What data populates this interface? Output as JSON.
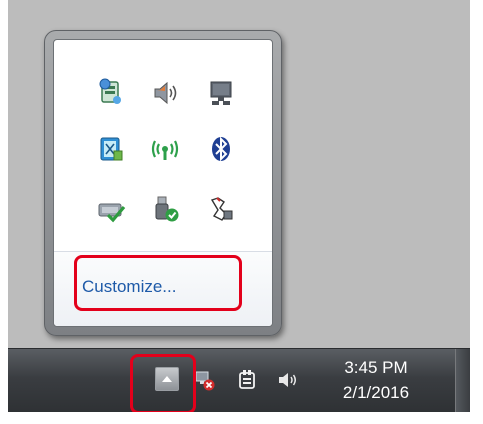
{
  "flyout": {
    "customize_label": "Customize...",
    "icons": [
      "action-center-flag-icon",
      "volume-icon",
      "network-computer-icon",
      "power-options-icon",
      "wireless-network-icon",
      "bluetooth-icon",
      "network-connected-icon",
      "usb-safely-remove-icon",
      "windows-update-icon"
    ]
  },
  "taskbar": {
    "clock_time": "3:45 PM",
    "clock_date": "2/1/2016",
    "tray_icons": [
      "network-disconnected-icon",
      "power-plugged-icon",
      "volume-icon"
    ]
  },
  "colors": {
    "highlight": "#e3001b",
    "link": "#1e5aa8",
    "taskbar": "#3a3d41"
  }
}
